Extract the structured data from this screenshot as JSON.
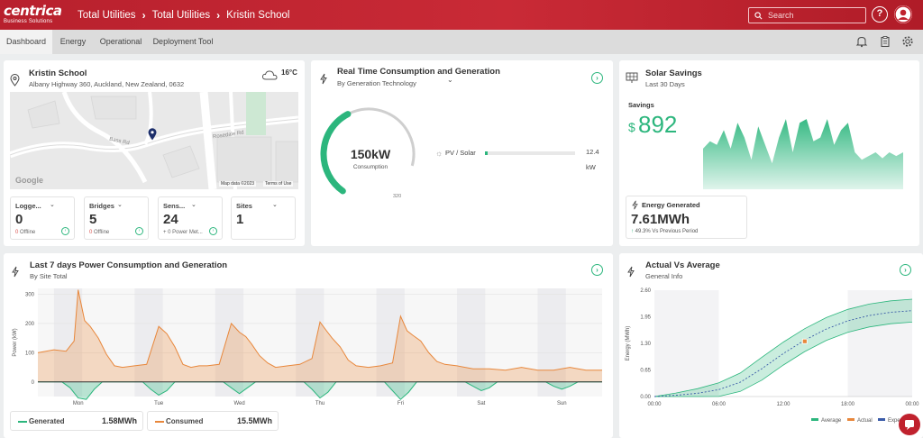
{
  "header": {
    "logo": "centrica",
    "logo_sub": "Business Solutions",
    "breadcrumbs": [
      "Total Utilities",
      "Total Utilities",
      "Kristin School"
    ],
    "search_placeholder": "Search",
    "help_label": "?"
  },
  "tabs": [
    "Dashboard",
    "Energy",
    "Operational",
    "Deployment Tool"
  ],
  "site": {
    "name": "Kristin School",
    "address": "Albany Highway 360, Auckland, New Zealand, 0632",
    "temperature": "16°C",
    "map_labels": {
      "road1": "Bass Rd",
      "road2": "Rosedale Rd",
      "google": "Google",
      "attribution": "Map data ©2023",
      "terms": "Terms of Use"
    },
    "stats": [
      {
        "label": "Logge...",
        "value": "0",
        "foot_count": "0",
        "foot_text": "Offline"
      },
      {
        "label": "Bridges",
        "value": "5",
        "foot_count": "0",
        "foot_text": "Offline"
      },
      {
        "label": "Sens...",
        "value": "24",
        "foot_count": "",
        "foot_text": "+ 0 Power Met..."
      },
      {
        "label": "Sites",
        "value": "1",
        "foot_count": "",
        "foot_text": ""
      }
    ]
  },
  "realtime": {
    "title": "Real Time Consumption and Generation",
    "subtitle": "By Generation Technology",
    "gauge_value": "150kW",
    "gauge_label": "Consumption",
    "gauge_max": "320",
    "gauge_fraction": 0.47,
    "source_label": "PV / Solar",
    "source_value": "12.4",
    "source_unit": "kW",
    "source_fraction": 0.03
  },
  "solar": {
    "title": "Solar Savings",
    "subtitle": "Last 30 Days",
    "savings_label": "Savings",
    "currency": "$",
    "amount": "892",
    "energy_label": "Energy Generated",
    "energy_value": "7.61MWh",
    "change": "49.3%",
    "change_text": "Vs Previous Period",
    "sparkline": [
      0.55,
      0.65,
      0.6,
      0.8,
      0.55,
      0.9,
      0.7,
      0.4,
      0.85,
      0.6,
      0.35,
      0.7,
      0.95,
      0.5,
      0.9,
      0.95,
      0.65,
      0.7,
      0.95,
      0.6,
      0.8,
      0.9,
      0.5,
      0.4,
      0.45,
      0.5,
      0.42,
      0.5,
      0.45,
      0.5
    ],
    "colors": {
      "accent": "#2cb67d"
    }
  },
  "power": {
    "title": "Last 7 days Power Consumption and Generation",
    "subtitle": "By Site Total",
    "legend": [
      {
        "name": "Generated",
        "value": "1.58MWh",
        "color": "#2cb67d"
      },
      {
        "name": "Consumed",
        "value": "15.5MWh",
        "color": "#e8873b"
      }
    ]
  },
  "actual": {
    "title": "Actual Vs Average",
    "subtitle": "General Info",
    "legend": [
      "Average",
      "Actual",
      "Expe..."
    ]
  },
  "chart_data": [
    {
      "type": "area",
      "title": "Last 7 days Power Consumption and Generation",
      "ylabel": "Power (kW)",
      "ylim": [
        -50,
        320
      ],
      "yticks": [
        0,
        100,
        200,
        300
      ],
      "categories": [
        "Mon",
        "Tue",
        "Wed",
        "Thu",
        "Fri",
        "Sat",
        "Sun"
      ],
      "series": [
        {
          "name": "Consumed",
          "color": "#e8873b",
          "x": [
            -0.5,
            -0.3,
            -0.15,
            -0.05,
            0.0,
            0.08,
            0.15,
            0.25,
            0.35,
            0.45,
            0.55,
            0.7,
            0.85,
            1.0,
            1.1,
            1.2,
            1.3,
            1.4,
            1.5,
            1.6,
            1.75,
            1.9,
            2.0,
            2.08,
            2.15,
            2.25,
            2.35,
            2.45,
            2.6,
            2.75,
            2.9,
            3.0,
            3.08,
            3.15,
            3.25,
            3.35,
            3.45,
            3.6,
            3.75,
            3.9,
            4.0,
            4.08,
            4.15,
            4.25,
            4.35,
            4.45,
            4.55,
            4.7,
            4.9,
            5.1,
            5.3,
            5.5,
            5.7,
            5.9,
            6.1,
            6.3,
            6.5
          ],
          "values": [
            100,
            110,
            105,
            140,
            315,
            210,
            190,
            150,
            95,
            55,
            50,
            55,
            60,
            190,
            165,
            120,
            60,
            50,
            55,
            55,
            60,
            200,
            170,
            155,
            130,
            90,
            65,
            50,
            55,
            60,
            80,
            205,
            175,
            150,
            120,
            75,
            55,
            50,
            55,
            65,
            225,
            175,
            160,
            140,
            100,
            70,
            60,
            55,
            45,
            45,
            40,
            50,
            40,
            40,
            50,
            40,
            40
          ]
        },
        {
          "name": "Generated",
          "color": "#2cb67d",
          "x": [
            -0.5,
            -0.2,
            -0.1,
            0.0,
            0.1,
            0.2,
            0.3,
            0.8,
            0.9,
            1.0,
            1.1,
            1.2,
            1.8,
            1.9,
            2.0,
            2.1,
            2.2,
            2.8,
            2.9,
            3.0,
            3.1,
            3.2,
            3.8,
            3.9,
            4.0,
            4.1,
            4.2,
            4.8,
            4.9,
            5.0,
            5.1,
            5.2,
            5.8,
            5.9,
            6.0,
            6.1,
            6.2,
            6.5
          ],
          "values": [
            0,
            0,
            -20,
            -55,
            -60,
            -25,
            0,
            0,
            -25,
            -45,
            -30,
            0,
            0,
            -20,
            -40,
            -20,
            0,
            0,
            -25,
            -55,
            -35,
            0,
            0,
            -30,
            -60,
            -35,
            0,
            0,
            -15,
            -30,
            -20,
            0,
            0,
            -15,
            -25,
            -15,
            0,
            0
          ]
        }
      ]
    },
    {
      "type": "line",
      "title": "Actual Vs Average",
      "ylabel": "Energy (MWh)",
      "x_ticks": [
        "00:00",
        "06:00",
        "12:00",
        "18:00",
        "00:00"
      ],
      "xlim": [
        0,
        24
      ],
      "ylim": [
        0,
        2.6
      ],
      "yticks": [
        0,
        0.65,
        1.3,
        1.95,
        2.6
      ],
      "series": [
        {
          "name": "Average",
          "color": "#2cb67d",
          "x": [
            0,
            2,
            4,
            6,
            8,
            10,
            12,
            14,
            16,
            18,
            20,
            22,
            24
          ],
          "values": [
            0,
            0.03,
            0.08,
            0.17,
            0.35,
            0.68,
            1.05,
            1.38,
            1.65,
            1.85,
            1.98,
            2.06,
            2.1
          ]
        },
        {
          "name": "Actual",
          "color": "#e8873b",
          "x": [
            14
          ],
          "values": [
            1.35
          ]
        },
        {
          "name": "Expected",
          "color": "#3a5ba8",
          "x": [
            0,
            2,
            4,
            6,
            8,
            10,
            12,
            14,
            16,
            18,
            20,
            22,
            24
          ],
          "values": [
            0,
            0.03,
            0.08,
            0.17,
            0.35,
            0.68,
            1.05,
            1.38,
            1.65,
            1.85,
            1.98,
            2.06,
            2.1
          ]
        }
      ]
    }
  ]
}
